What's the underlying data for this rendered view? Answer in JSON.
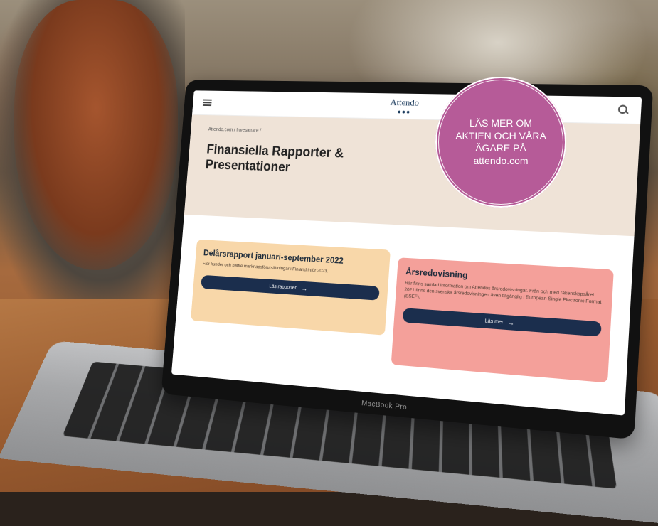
{
  "site": {
    "logo_text": "Attendo",
    "breadcrumb": "Attendo.com / Investerare /",
    "page_title": "Finansiella Rapporter & Presentationer"
  },
  "cards": {
    "report": {
      "title": "Delårsrapport januari-september 2022",
      "description": "Fler kunder och bättre marknadsförutsättningar i Finland inför 2023.",
      "button_label": "Läs rapporten"
    },
    "annual": {
      "title": "Årsredovisning",
      "description": "Här finns samlad information om Attendos årsredovisningar. Från och med räkenskapsåret 2021 finns den svenska årsredovisningen även tillgänglig i European Single Electronic Format (ESEF).",
      "button_label": "Läs mer"
    }
  },
  "laptop": {
    "brand": "MacBook Pro"
  },
  "promo": {
    "line1": "LÄS MER OM",
    "line2": "AKTIEN  OCH VÅRA",
    "line3": "ÄGARE PÅ",
    "line4": "attendo.com"
  },
  "icons": {
    "menu": "menu-icon",
    "search": "search-icon",
    "arrow": "arrow-right-icon"
  },
  "colors": {
    "promo_bg": "#b65b98",
    "card_report_bg": "#f8d7a9",
    "card_annual_bg": "#f4a09a",
    "button_bg": "#1b2e4d",
    "hero_bg": "#efe3d7"
  }
}
